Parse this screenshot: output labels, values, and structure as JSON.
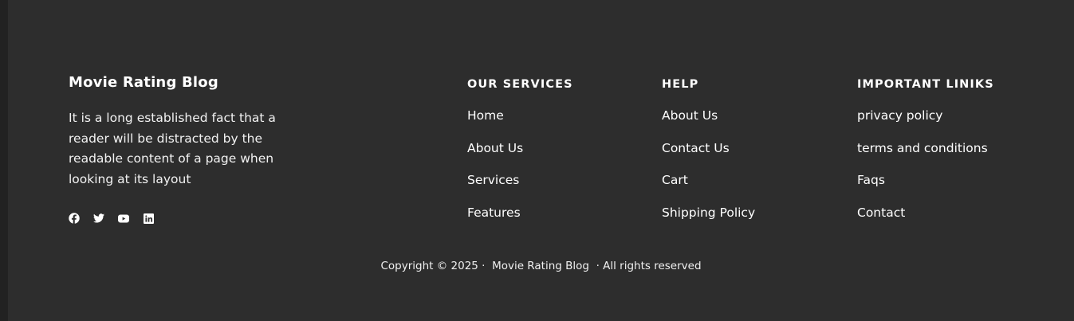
{
  "brand": {
    "title": "Movie Rating Blog",
    "description": "It is a long established fact that a reader will be distracted by the readable content of a page when looking at its layout"
  },
  "social": [
    {
      "name": "facebook-icon"
    },
    {
      "name": "twitter-icon"
    },
    {
      "name": "youtube-icon"
    },
    {
      "name": "linkedin-icon"
    }
  ],
  "columns": {
    "services": {
      "heading": "OUR SERVICES",
      "links": [
        "Home",
        "About Us",
        "Services",
        "Features"
      ]
    },
    "help": {
      "heading": "HELP",
      "links": [
        "About Us",
        "Contact Us",
        "Cart",
        "Shipping Policy"
      ]
    },
    "important": {
      "heading": "IMPORTANT LINIKS",
      "links": [
        "privacy policy",
        "terms and conditions",
        "Faqs",
        "Contact"
      ]
    }
  },
  "copyright": {
    "prefix": "Copyright © 2025 ·",
    "brand": "Movie Rating Blog",
    "suffix": "· All rights reserved"
  },
  "colors": {
    "background": "#2d2d2d",
    "left_strip": "#222222",
    "text": "#ffffff"
  }
}
